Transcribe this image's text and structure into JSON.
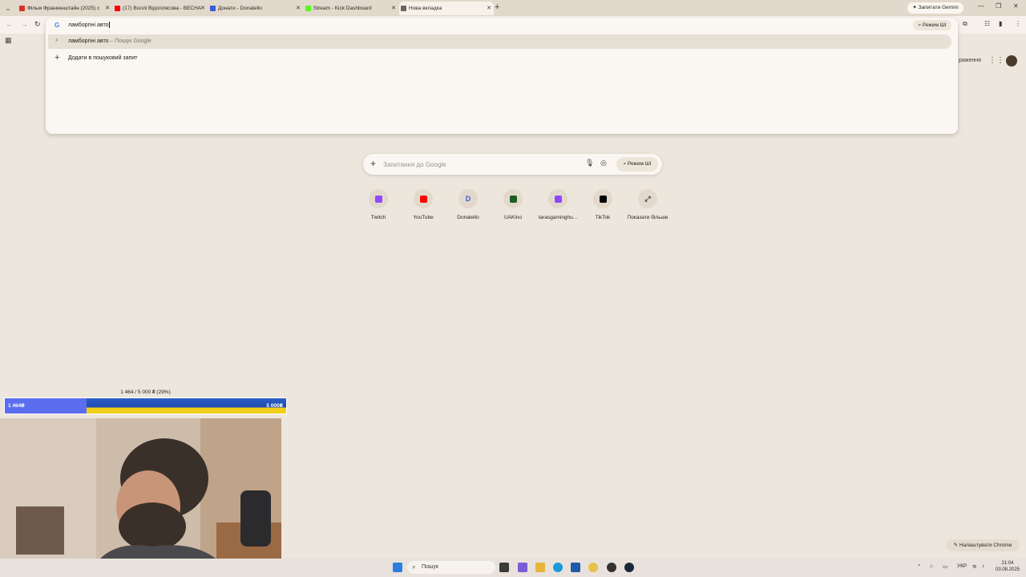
{
  "browser": {
    "tabs": [
      {
        "title": "Фільм Франкенштайн (2025) с",
        "favicon_color": "#d93025",
        "active": false
      },
      {
        "title": "(17) Воллі Відоплясова - ВЕСНА",
        "favicon_color": "#ff0000",
        "active": false
      },
      {
        "title": "Донати - Donatello",
        "favicon_color": "#3b5bdb",
        "active": false
      },
      {
        "title": "Stream - Kick Dashboard",
        "favicon_color": "#53fc18",
        "active": false
      },
      {
        "title": "Нова вкладка",
        "favicon_color": "#6a645c",
        "active": true
      }
    ],
    "gemini_button": "Запитати Gemini"
  },
  "omnibox": {
    "typed_text": "ламборгіні авто",
    "ai_mode": "Режим ШІ",
    "suggestion": {
      "query": "ламборгіні авто",
      "source": "Пошук Google"
    },
    "add_to_query": "Додати в пошуковий запит"
  },
  "ntp": {
    "partial_header_text": "раження",
    "search_placeholder": "Запитання до Google",
    "search_ai_mode": "Режим ШІ",
    "shortcuts": [
      {
        "label": "Twitch",
        "glyph": "",
        "color": "#9146ff"
      },
      {
        "label": "YouTube",
        "glyph": "",
        "color": "#ff0000"
      },
      {
        "label": "Donatello",
        "glyph": "D",
        "color": "#3b5bdb"
      },
      {
        "label": "UAKino",
        "glyph": "",
        "color": "#1b5e20"
      },
      {
        "label": "tarasgaminghu...",
        "glyph": "",
        "color": "#9146ff"
      },
      {
        "label": "TikTok",
        "glyph": "",
        "color": "#000000"
      },
      {
        "label": "Показати більше",
        "glyph": "⤢",
        "color": "#3d3833"
      }
    ],
    "customize": "Налаштувати Chrome"
  },
  "donation_goal": {
    "summary": "1 464 / 5 000 ₴ (29%)",
    "current": "1 464₴",
    "goal": "5 000₴",
    "progress_fraction": 0.29
  },
  "taskbar": {
    "search_label": "Пошук",
    "lang": "УКР",
    "time": "21:04",
    "date": "03.08.2025"
  }
}
